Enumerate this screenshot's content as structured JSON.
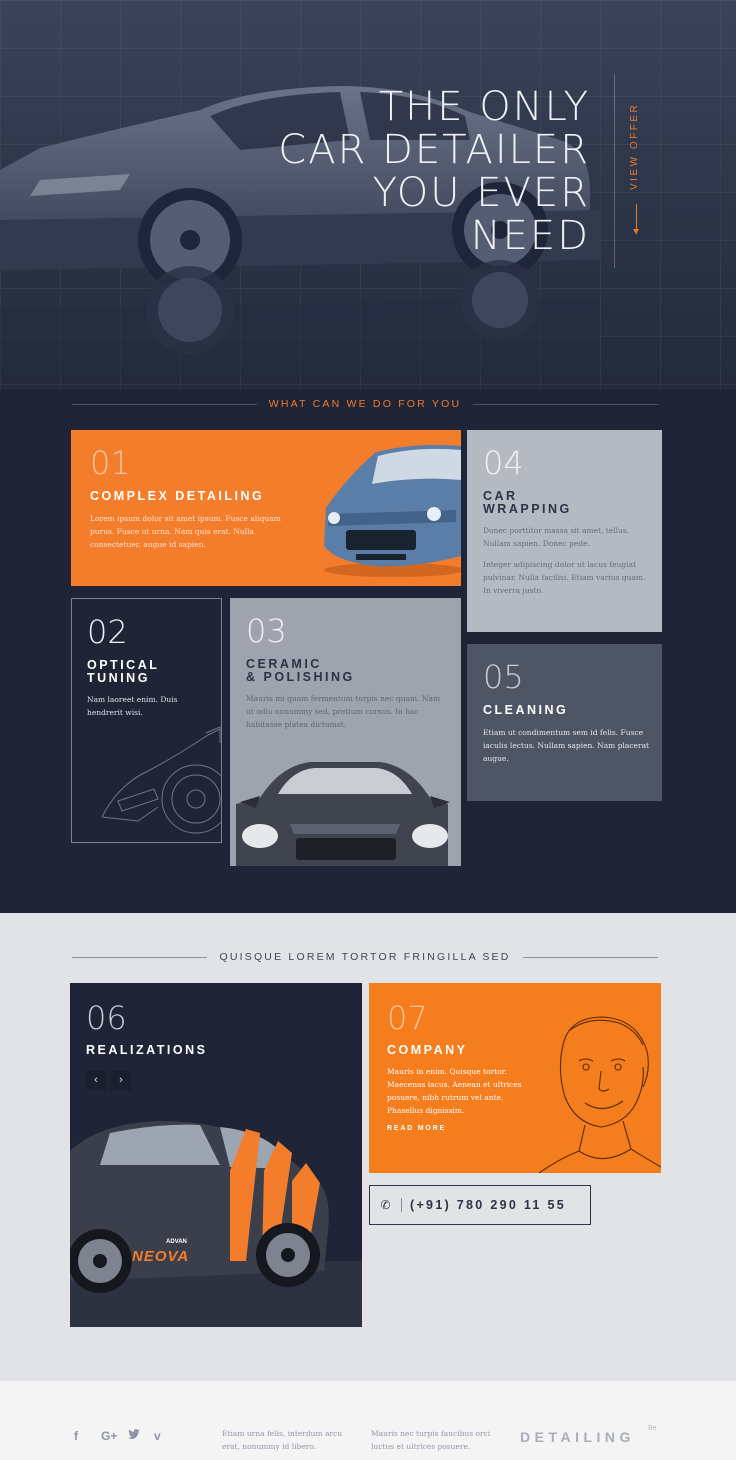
{
  "hero": {
    "title": "THE ONLY\nCAR DETAILER\nYOU EVER\nNEED",
    "cta": "VIEW OFFER"
  },
  "services": {
    "heading": "WHAT CAN WE DO FOR YOU",
    "items": [
      {
        "num": "01",
        "title": "COMPLEX DETAILING",
        "desc": "Lorem ipsum dolor sit amet ipsum. Fusce aliquam purus. Fusce ut urna. Nam quis erat. Nulla consectetuer, augue id sapien."
      },
      {
        "num": "02",
        "title": "OPTICAL\nTUNING",
        "desc": "Nam laoreet enim. Duis hendrerit wisi."
      },
      {
        "num": "03",
        "title": "CERAMIC\n& POLISHING",
        "desc": "Mauris mi quam fermentum turpis nec quam. Nam ut odio nonummy sed, pretium cursus. In hac habitasse platea dictumst."
      },
      {
        "num": "04",
        "title": "CAR\nWRAPPING",
        "desc": "Donec porttitor massa sit amet, tellus. Nullam sapien. Donec pede.",
        "desc2": "Integer adipiscing dolor ut lacus feugiat pulvinar. Nulla facilisi. Etiam varius quam. In viverra justo."
      },
      {
        "num": "05",
        "title": "CLEANING",
        "desc": "Etiam ut condimentum sem id felis. Fusce iaculis lectus. Nullam sapien. Nam placerat augue."
      }
    ]
  },
  "about": {
    "heading": "QUISQUE LOREM TORTOR FRINGILLA SED",
    "realizations": {
      "num": "06",
      "title": "REALIZATIONS",
      "car_brand": "NEOVA",
      "car_sub": "ADVAN"
    },
    "company": {
      "num": "07",
      "title": "COMPANY",
      "desc": "Mauris in enim. Quisque tortor. Maecenas lacus. Aenean et ultrices posuere, nibh rutrum vel ante. Phasellus dignissim.",
      "link": "READ MORE"
    },
    "phone": "(+91) 780 290 11 55"
  },
  "footer": {
    "col1": "Etiam urna felis, interdum arcu erat, nonummy id libero.",
    "col2": "Mauris nec turpis faucibus orci luctus et ultrices posuere.",
    "brand": "DETAILING",
    "badge": "Be",
    "socials": [
      "facebook-icon",
      "google-plus-icon",
      "twitter-icon",
      "vimeo-icon"
    ]
  },
  "colors": {
    "accent": "#f47d2c",
    "navy": "#1f2537",
    "light": "#e2e3e6"
  }
}
